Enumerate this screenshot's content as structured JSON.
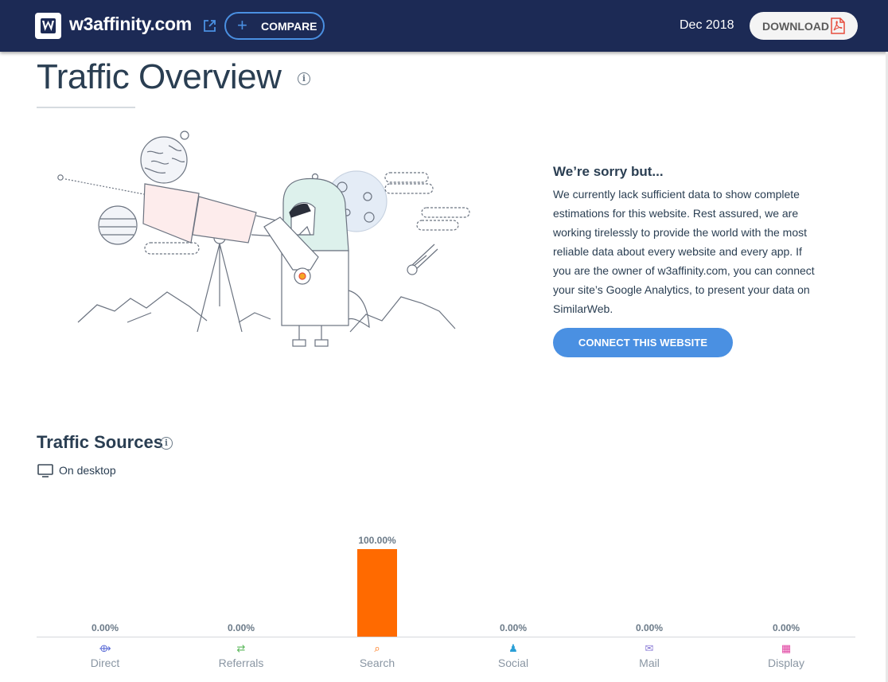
{
  "header": {
    "site_name": "w3affinity.com",
    "compare_label": "COMPARE",
    "date": "Dec 2018",
    "download_label": "DOWNLOAD"
  },
  "overview": {
    "title": "Traffic Overview",
    "sorry_title": "We’re sorry but...",
    "sorry_text": "We currently lack sufficient data to show complete estimations for this website. Rest assured, we are working tirelessly to provide the world with the most reliable data about every website and every app. If you are the owner of w3affinity.com, you can connect your site’s Google Analytics, to present your data on SimilarWeb.",
    "connect_label": "CONNECT THIS WEBSITE"
  },
  "sources": {
    "title": "Traffic Sources",
    "device_label": "On desktop"
  },
  "colors": {
    "header_bg": "#1c2a55",
    "accent_blue": "#4a90e2",
    "bar_orange": "#ff6a00"
  },
  "chart_data": {
    "type": "bar",
    "categories": [
      "Direct",
      "Referrals",
      "Search",
      "Social",
      "Mail",
      "Display"
    ],
    "values": [
      0,
      0,
      100,
      0,
      0,
      0
    ],
    "value_labels": [
      "0.00%",
      "0.00%",
      "100.00%",
      "0.00%",
      "0.00%",
      "0.00%"
    ],
    "category_icons": [
      "direct-icon",
      "referrals-icon",
      "search-icon",
      "social-icon",
      "mail-icon",
      "display-icon"
    ],
    "category_colors": [
      "#5a6bd6",
      "#5cb85c",
      "#ff6a00",
      "#2a9fd6",
      "#8a7bd6",
      "#e040a0"
    ],
    "ylim": [
      0,
      100
    ],
    "grid": false,
    "title": "",
    "xlabel": "",
    "ylabel": ""
  }
}
